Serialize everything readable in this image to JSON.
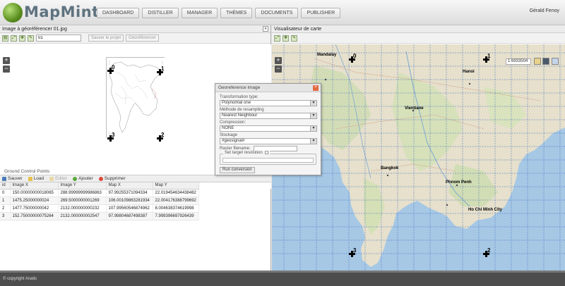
{
  "app": {
    "logo_text": "MapMint",
    "user_name": "Gérald Fenoy",
    "nav": [
      "DASHBOARD",
      "DISTILLER",
      "MANAGER",
      "THÈMES",
      "DOCUMENTS",
      "PUBLISHER"
    ]
  },
  "left_panel": {
    "title": "Image à géoréférencer 01.jpg",
    "project_input_value": "01",
    "save_project_label": "Sauver le projet",
    "georeference_label": "Géoréférencer",
    "zoom_in": "+",
    "zoom_out": "−",
    "markers": [
      "0",
      "1",
      "2",
      "3"
    ]
  },
  "gcp": {
    "title": "Ground Control Points",
    "actions": [
      "Sauver",
      "Load",
      "Editer",
      "Ajouter",
      "Supprimer"
    ],
    "columns": [
      "id",
      "Image X",
      "Image Y",
      "Map X",
      "Map Y"
    ],
    "rows": [
      [
        "0",
        "150.00000000018065",
        "288.99999999986863",
        "97.99255371094334",
        "22.019454634438482"
      ],
      [
        "1",
        "1475.25000000024",
        "269.5000000001269",
        "106.00109863281934",
        "22.004176388799692"
      ],
      [
        "2",
        "1477.75000000042",
        "2132.000000000232",
        "107.99560546874962",
        "8.004638374619998"
      ],
      [
        "3",
        "152.75000000075264",
        "2132.000000002547",
        "97.99804687498387",
        "7.999396697926439"
      ]
    ]
  },
  "right_panel": {
    "title": "Visualisateur de carte",
    "scale_value": "1:6933504",
    "markers": [
      "0",
      "1",
      "2",
      "3"
    ],
    "city_labels": [
      "Mandalay",
      "Hanoi",
      "Vientiane",
      "Bangkok",
      "Ho Chi Minh City",
      "Phnom Penh"
    ]
  },
  "dialog": {
    "title": "Georeference image",
    "transformation_label": "Transformation type:",
    "transformation_value": "Polynomial one",
    "resampling_label": "Méthode de resampling",
    "resampling_value": "Nearest Neighbour",
    "compression_label": "Compression:",
    "compression_value": "NONE",
    "stockage_label": "Stockage",
    "stockage_value": "#geosignal#",
    "raster_filename_label": "Raster filename:",
    "target_resolution_label": "Set target resolution",
    "run_label": "Run conversion"
  },
  "footer": {
    "copyright": "© copyright Analis"
  }
}
